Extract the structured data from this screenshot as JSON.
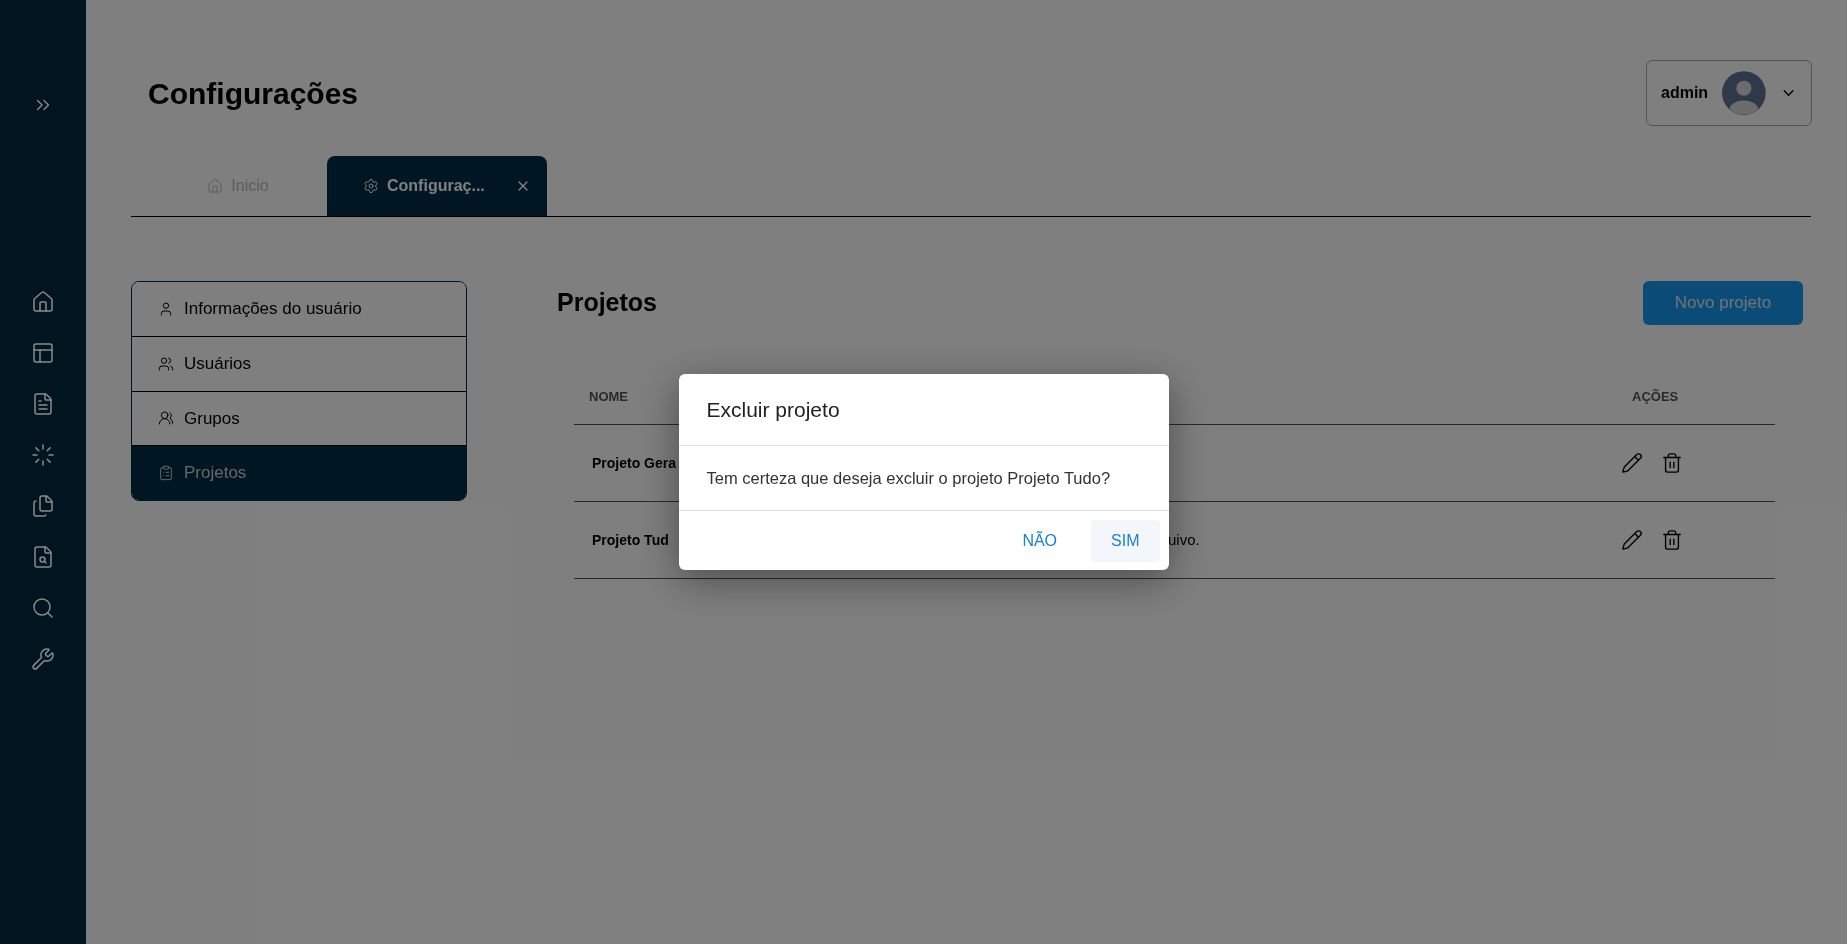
{
  "page_title": "Configurações",
  "user_menu": {
    "name": "admin"
  },
  "tabs": [
    {
      "label": "Inicio",
      "selected": false
    },
    {
      "label": "Configuraç...",
      "selected": true
    }
  ],
  "settings_menu": [
    {
      "label": "Informações do usuário",
      "selected": false
    },
    {
      "label": "Usuários",
      "selected": false
    },
    {
      "label": "Grupos",
      "selected": false
    },
    {
      "label": "Projetos",
      "selected": true
    }
  ],
  "section": {
    "title": "Projetos",
    "new_button": "Novo projeto"
  },
  "table": {
    "columns": [
      "NOME",
      "AÇÕES"
    ],
    "rows": [
      {
        "name": "Projeto Gera"
      },
      {
        "name": "Projeto Tud",
        "description": "uivo."
      }
    ]
  },
  "dialog": {
    "title": "Excluir projeto",
    "message": "Tem certeza que deseja excluir o projeto Projeto Tudo?",
    "buttons": [
      {
        "label": "NÃO",
        "focused": false
      },
      {
        "label": "SIM",
        "focused": true
      }
    ]
  }
}
